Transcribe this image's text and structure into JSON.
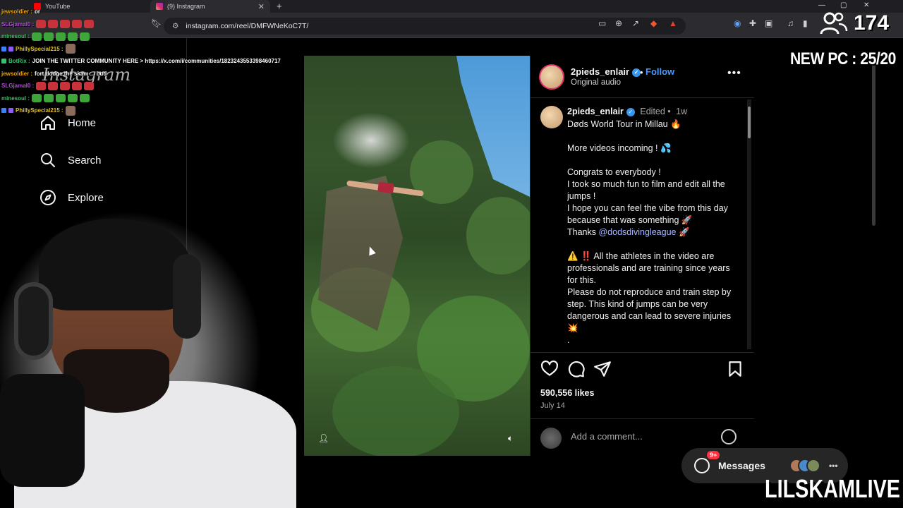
{
  "browser": {
    "tabs": [
      {
        "title": "YouTube"
      },
      {
        "title": "(9) Instagram"
      }
    ],
    "new_tab": "+",
    "url": "instagram.com/reel/DMFWNeKoC7T/"
  },
  "instagram": {
    "logo": "Instagram",
    "nav": [
      {
        "label": "Home",
        "icon": "home-icon"
      },
      {
        "label": "Search",
        "icon": "search-icon"
      },
      {
        "label": "Explore",
        "icon": "compass-icon"
      }
    ],
    "post": {
      "username": "2pieds_enlair",
      "follow_label": "Follow",
      "audio": "Original audio",
      "caption_meta": "Edited •",
      "caption_age": "1w",
      "caption": {
        "line1": "Døds World Tour in Millau 🔥",
        "line2": "More videos incoming ! 💦",
        "line3": "Congrats to everybody !",
        "line4": "I took so much fun to film and edit all the jumps !",
        "line5": "I hope you can feel the vibe from this day because that was something 🚀",
        "line6_prefix": "Thanks",
        "mention": "@dodsdivingleague",
        "line6_suffix": "🚀",
        "line7": "⚠️ ‼️ All the athletes in the video are professionals and are training since years for this.",
        "line8": "Please do not reproduce and train step by step. This kind of jumps can be very dangerous and can lead to severe injuries 💥",
        "line9": "."
      },
      "likes": "590,556 likes",
      "date": "July 14",
      "comment_placeholder": "Add a comment..."
    },
    "messages": {
      "label": "Messages",
      "badge": "9+"
    }
  },
  "overlay": {
    "chat": [
      {
        "user": "jewsoldier :",
        "msg": "or",
        "color": "#f0a500"
      },
      {
        "user": "SLGjamal0 :",
        "msg": "",
        "color": "#b04bd8",
        "emotes": "red"
      },
      {
        "user": "minesoul :",
        "msg": "",
        "color": "#40c060",
        "emotes": "green"
      },
      {
        "user": "PhillySpecial215 :",
        "msg": "",
        "color": "#e0c020",
        "emotes": "pic"
      },
      {
        "user": "BotRix :",
        "msg": "JOIN THE TWITTER COMMUNITY HERE > https://x.com/i/communities/1823243553398460717",
        "color": "#38c070"
      },
      {
        "user": "jewsoldier :",
        "msg": "fort dodge the skam ... bud",
        "color": "#f0a500"
      },
      {
        "user": "SLGjamal0 :",
        "msg": "",
        "color": "#b04bd8",
        "emotes": "red"
      },
      {
        "user": "minesoul :",
        "msg": "",
        "color": "#40c060",
        "emotes": "green"
      },
      {
        "user": "PhillySpecial215 :",
        "msg": "",
        "color": "#e0c020",
        "emotes": "pic"
      }
    ],
    "viewer_count": "174",
    "new_pc": "NEW PC : 25/20",
    "brand": "LILSKAMLIVE"
  }
}
